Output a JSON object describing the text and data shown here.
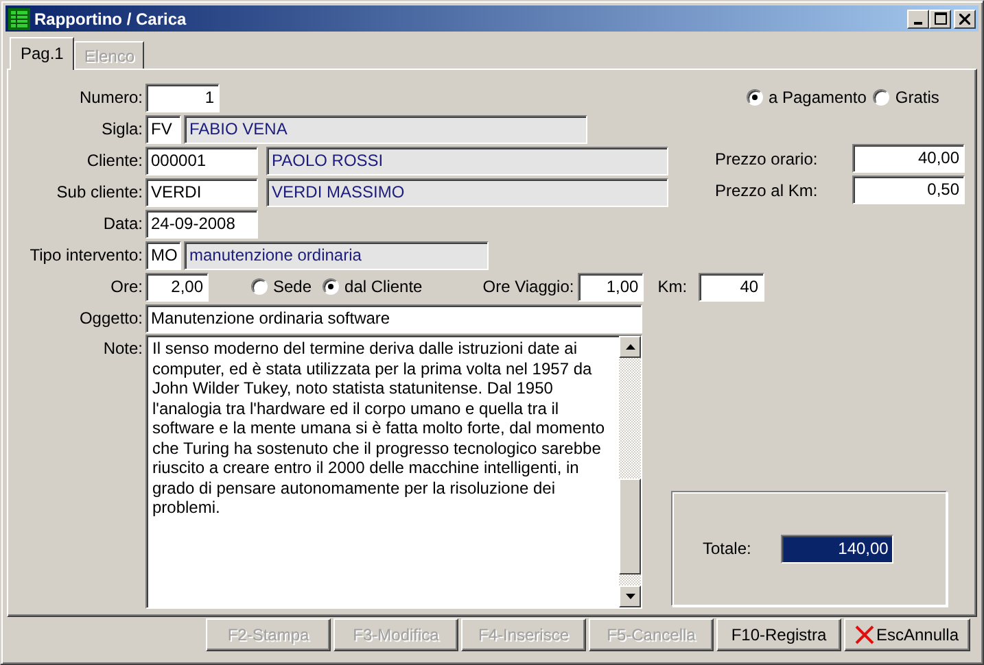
{
  "window": {
    "title": "Rapportino / Carica"
  },
  "tabs": [
    {
      "label": "Pag.1",
      "selected": true,
      "disabled": false
    },
    {
      "label": "Elenco",
      "selected": false,
      "disabled": true
    }
  ],
  "fields": [
    {
      "kind": "number",
      "label": "Numero:",
      "value": "1"
    },
    {
      "kind": "code",
      "label": "Sigla:",
      "code": "FV",
      "description": "FABIO VENA"
    },
    {
      "kind": "client",
      "label": "Cliente:",
      "code": "000001",
      "description": "PAOLO ROSSI"
    },
    {
      "kind": "client",
      "label": "Sub cliente:",
      "code": "VERDI",
      "description": "VERDI MASSIMO"
    },
    {
      "kind": "date",
      "label": "Data:",
      "value": "24-09-2008"
    },
    {
      "kind": "code",
      "label": "Tipo intervento:",
      "code": "MO",
      "description": "manutenzione ordinaria"
    }
  ],
  "billing": [
    {
      "label": "a Pagamento",
      "selected": true
    },
    {
      "label": "Gratis",
      "selected": false
    }
  ],
  "prices": [
    {
      "label": "Prezzo orario:",
      "value": "40,00"
    },
    {
      "label": "Prezzo al Km:",
      "value": "0,50"
    }
  ],
  "ore": {
    "label": "Ore:",
    "value": "2,00"
  },
  "location": [
    {
      "label": "Sede",
      "selected": false
    },
    {
      "label": "dal Cliente",
      "selected": true
    }
  ],
  "ore_viaggio": {
    "label": "Ore Viaggio:",
    "value": "1,00"
  },
  "km": {
    "label": "Km:",
    "value": "40"
  },
  "oggetto": {
    "label": "Oggetto:",
    "value": "Manutenzione ordinaria software"
  },
  "note": {
    "label": "Note:",
    "value": "Il senso moderno del termine deriva dalle istruzioni date ai computer, ed è stata utilizzata per la prima volta nel 1957 da John Wilder Tukey, noto statista statunitense. Dal 1950 l'analogia tra l'hardware ed il corpo umano e quella tra il software e la mente umana si è fatta molto forte, dal momento che Turing ha sostenuto che il progresso tecnologico sarebbe riuscito a creare entro il 2000 delle macchine intelligenti, in grado di pensare autonomamente per la risoluzione dei problemi."
  },
  "totale": {
    "label": "Totale:",
    "value": "140,00"
  },
  "buttons": [
    {
      "kind": "plain",
      "label": "F2-Stampa",
      "disabled": true
    },
    {
      "kind": "plain",
      "label": "F3-Modifica",
      "disabled": true
    },
    {
      "kind": "plain",
      "label": "F4-Inserisce",
      "disabled": true
    },
    {
      "kind": "plain",
      "label": "F5-Cancella",
      "disabled": true
    },
    {
      "kind": "plain",
      "label": "F10-Registra",
      "disabled": false
    },
    {
      "kind": "cancel",
      "label": "EscAnnulla",
      "disabled": false
    }
  ]
}
